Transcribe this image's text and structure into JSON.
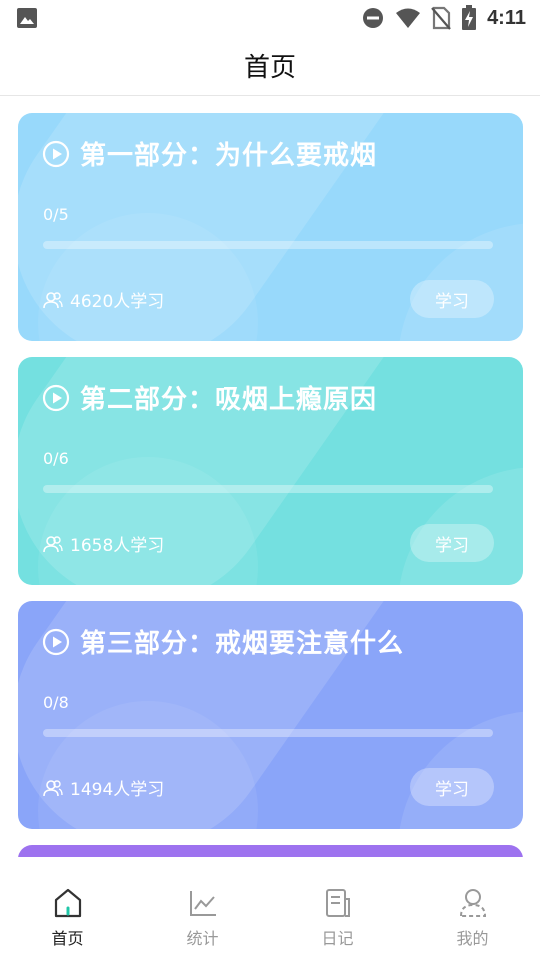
{
  "status_bar": {
    "time": "4:11",
    "icons": [
      "image-icon",
      "do-not-disturb-icon",
      "wifi-icon",
      "no-sim-icon",
      "battery-charging-icon"
    ]
  },
  "header": {
    "title": "首页"
  },
  "cards": [
    {
      "title": "第一部分：为什么要戒烟",
      "progress_label": "0/5",
      "progress": 0,
      "learners": "4620人学习",
      "button": "学习",
      "color": "#98d9fb"
    },
    {
      "title": "第二部分：吸烟上瘾原因",
      "progress_label": "0/6",
      "progress": 0,
      "learners": "1658人学习",
      "button": "学习",
      "color": "#74e0e0"
    },
    {
      "title": "第三部分：戒烟要注意什么",
      "progress_label": "0/8",
      "progress": 0,
      "learners": "1494人学习",
      "button": "学习",
      "color": "#8aa5f9"
    }
  ],
  "next_card_color": "#9d72ef",
  "tabbar": {
    "tabs": [
      {
        "label": "首页",
        "icon": "home-icon",
        "active": true
      },
      {
        "label": "统计",
        "icon": "chart-icon",
        "active": false
      },
      {
        "label": "日记",
        "icon": "diary-icon",
        "active": false
      },
      {
        "label": "我的",
        "icon": "profile-icon",
        "active": false
      }
    ],
    "active_color": "#1fc7a8"
  }
}
